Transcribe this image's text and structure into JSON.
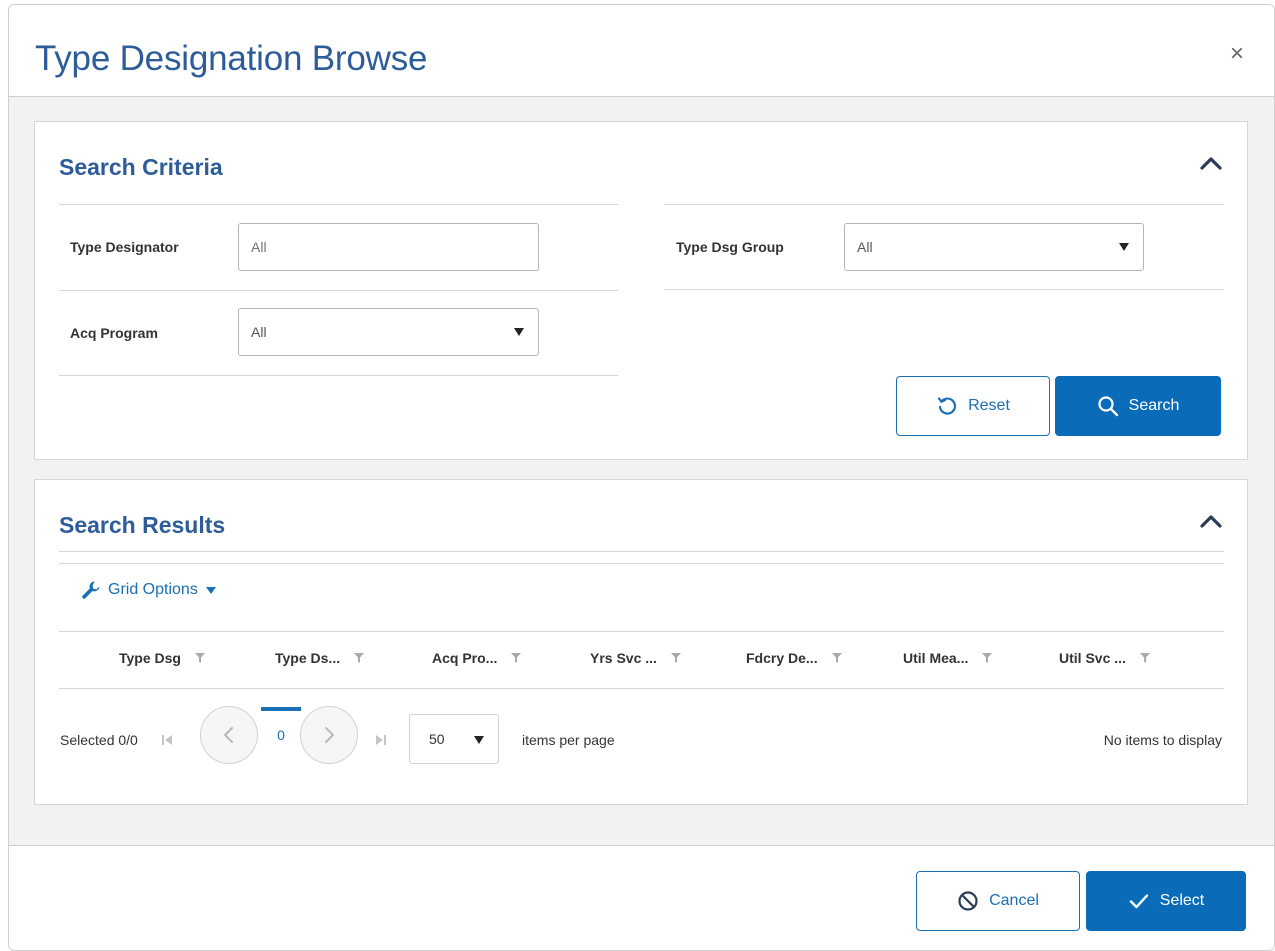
{
  "dialog": {
    "title": "Type Designation Browse",
    "close_glyph": "×"
  },
  "search_criteria": {
    "title": "Search Criteria",
    "fields": {
      "type_designator": {
        "label": "Type Designator",
        "value": "",
        "placeholder": "All"
      },
      "type_dsg_group": {
        "label": "Type Dsg Group",
        "value": "All"
      },
      "acq_program": {
        "label": "Acq Program",
        "value": "All"
      }
    },
    "reset_label": "Reset",
    "search_label": "Search"
  },
  "search_results": {
    "title": "Search Results",
    "grid_options_label": "Grid Options",
    "columns": [
      "Type Dsg",
      "Type Ds...",
      "Acq Pro...",
      "Yrs Svc ...",
      "Fdcry De...",
      "Util Mea...",
      "Util Svc ..."
    ],
    "pager": {
      "selected": "Selected 0/0",
      "current_page": "0",
      "page_size": "50",
      "items_per_page": "items per page",
      "status": "No items to display"
    }
  },
  "footer": {
    "cancel_label": "Cancel",
    "select_label": "Select"
  },
  "colors": {
    "accent": "#0a6cb9",
    "title_blue": "#2e5c99",
    "background": "#f2f2f2"
  },
  "icons": [
    "close-icon",
    "chevron-up-icon",
    "reset-icon",
    "search-icon",
    "wrench-icon",
    "filter-icon",
    "first-page-icon",
    "prev-page-icon",
    "next-page-icon",
    "last-page-icon",
    "cancel-icon",
    "check-icon"
  ]
}
